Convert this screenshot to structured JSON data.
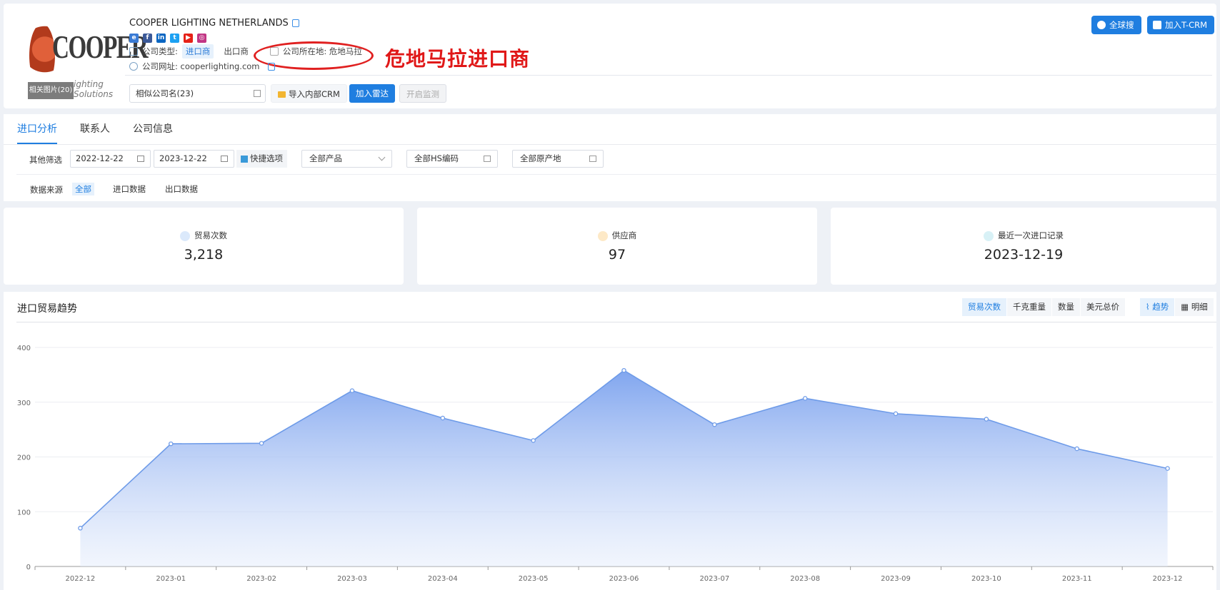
{
  "company": {
    "name": "COOPER LIGHTING NETHERLANDS",
    "logo_text": "COOPER",
    "logo_sub": "ighting Solutions",
    "related_images": "相关图片(20)",
    "social": [
      "ie-icon",
      "facebook-icon",
      "linkedin-icon",
      "twitter-icon",
      "youtube-icon",
      "instagram-icon"
    ],
    "type_label": "公司类型:",
    "type_importer": "进口商",
    "type_exporter": "出口商",
    "location": "公司所在地: 危地马拉",
    "website": "公司网址: cooperlighting.com"
  },
  "annotation": "危地马拉进口商",
  "actions": {
    "similar": "相似公司名(23)",
    "import_crm": "导入内部CRM",
    "add_radar": "加入雷达",
    "monitor": "开启监测",
    "global_search": "全球搜",
    "add_tcrm": "加入T-CRM"
  },
  "tabs": [
    "进口分析",
    "联系人",
    "公司信息"
  ],
  "filters": {
    "other_label": "其他筛选",
    "date_from": "2022-12-22",
    "date_to": "2023-12-22",
    "quick": "快捷选项",
    "product": "全部产品",
    "hs": "全部HS编码",
    "origin": "全部原产地",
    "source_label": "数据来源",
    "sources": [
      "全部",
      "进口数据",
      "出口数据"
    ]
  },
  "stats": [
    {
      "label": "贸易次数",
      "value": "3,218",
      "color": "#2f7fe0"
    },
    {
      "label": "供应商",
      "value": "97",
      "color": "#f0a020"
    },
    {
      "label": "最近一次进口记录",
      "value": "2023-12-19",
      "color": "#26b0c8"
    }
  ],
  "chart": {
    "title": "进口贸易趋势",
    "metrics": [
      "贸易次数",
      "千克重量",
      "数量",
      "美元总价"
    ],
    "views": [
      "趋势",
      "明细"
    ]
  },
  "chart_data": {
    "type": "area",
    "categories": [
      "2022-12",
      "2023-01",
      "2023-02",
      "2023-03",
      "2023-04",
      "2023-05",
      "2023-06",
      "2023-07",
      "2023-08",
      "2023-09",
      "2023-10",
      "2023-11",
      "2023-12"
    ],
    "values": [
      70,
      224,
      225,
      321,
      271,
      230,
      358,
      259,
      307,
      279,
      269,
      215,
      179
    ],
    "yticks": [
      0,
      100,
      200,
      300,
      400
    ],
    "ylim": [
      0,
      400
    ],
    "color": "#6e9be8"
  }
}
